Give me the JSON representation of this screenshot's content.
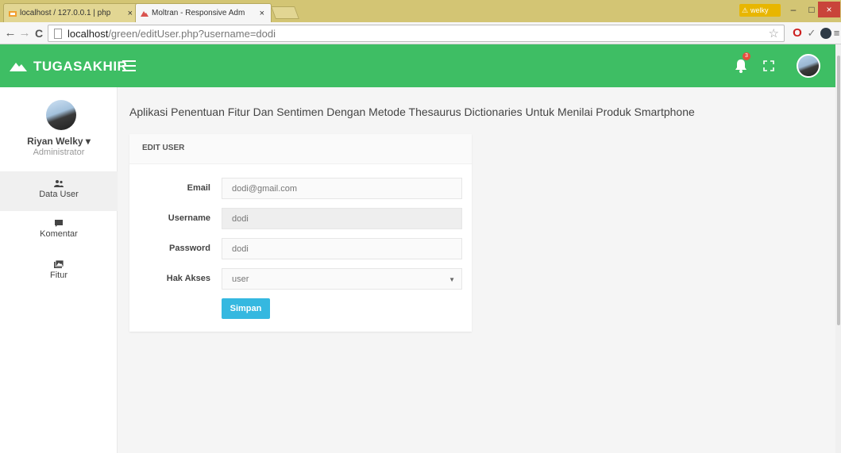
{
  "browser": {
    "tabs": [
      {
        "title": "localhost / 127.0.0.1 | php",
        "close": "×"
      },
      {
        "title": "Moltran - Responsive Adm",
        "close": "×"
      }
    ],
    "profile_name": "welky",
    "window_buttons": {
      "minimize": "–",
      "maximize": "□",
      "close": "×"
    },
    "url_host": "localhost",
    "url_path": "/green/editUser.php?username=dodi",
    "icons": [
      "back-icon",
      "forward-icon",
      "reload-icon",
      "page-icon",
      "star-icon",
      "opera-icon",
      "check-icon",
      "extension-icon",
      "menu-icon"
    ]
  },
  "header": {
    "brand": "TUGASAKHIR",
    "notification_count": "3",
    "bg_color": "#3ebe64"
  },
  "sidebar": {
    "user_name": "Riyan Welky",
    "user_caret": "▾",
    "user_role": "Administrator",
    "items": [
      {
        "label": "Data User",
        "icon": "users-icon",
        "active": true
      },
      {
        "label": "Komentar",
        "icon": "comment-icon",
        "active": false
      },
      {
        "label": "Fitur",
        "icon": "images-icon",
        "active": false
      }
    ]
  },
  "main": {
    "page_title": "Aplikasi Penentuan Fitur Dan Sentimen Dengan Metode Thesaurus Dictionaries Untuk Menilai Produk Smartphone",
    "panel_title": "EDIT USER",
    "form": {
      "email_label": "Email",
      "email_value": "dodi@gmail.com",
      "username_label": "Username",
      "username_value": "dodi",
      "password_label": "Password",
      "password_value": "dodi",
      "hak_akses_label": "Hak Akses",
      "hak_akses_value": "user",
      "submit_label": "Simpan"
    },
    "button_color": "#35b8e0"
  }
}
